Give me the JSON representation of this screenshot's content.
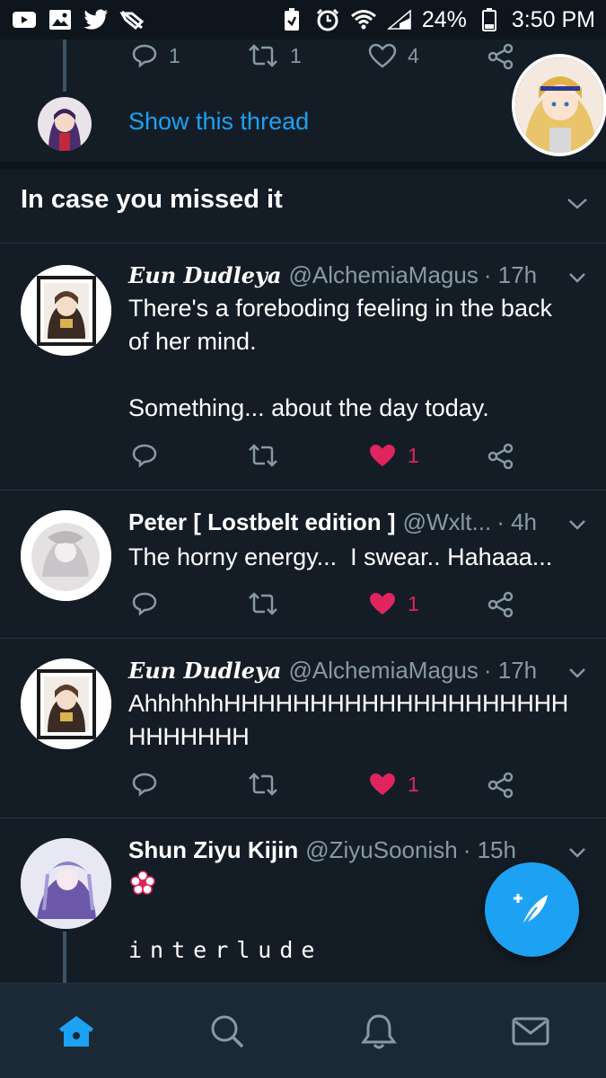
{
  "status_bar": {
    "battery_percent": "24%",
    "time": "3:50 PM"
  },
  "previous_tweet": {
    "reply_count": "1",
    "retweet_count": "1",
    "like_count": "4",
    "show_thread_label": "Show this thread"
  },
  "section": {
    "title": "In case you missed it"
  },
  "tweets": [
    {
      "name": "Eun Dudleya",
      "handle": "@AlchemiaMagus",
      "time": "· 17h",
      "text": "There's a foreboding feeling in the back\nof her mind.\n\nSomething... about the day today.",
      "like_count": "1"
    },
    {
      "name": "Peter [ Lostbelt edition ]",
      "handle": "@Wxlt...",
      "time": "· 4h",
      "text": "The horny energy...  I swear.. Hahaaa...",
      "like_count": "1"
    },
    {
      "name": "Eun Dudleya",
      "handle": "@AlchemiaMagus",
      "time": "· 17h",
      "text": "AhhhhhhHHHHHHHHHHHHHHHHHHHH\nHHHHHHH",
      "like_count": "1"
    },
    {
      "name": "Shun Ziyu Kijin",
      "handle": "@ZiyuSoonish",
      "time": "· 15h",
      "text": "interlude"
    }
  ],
  "colors": {
    "background": "#141d26",
    "accent": "#1da1f2",
    "like": "#e0245e",
    "muted": "#8899a6"
  },
  "bottom_nav": [
    "home-icon",
    "search-icon",
    "notifications-icon",
    "messages-icon"
  ]
}
